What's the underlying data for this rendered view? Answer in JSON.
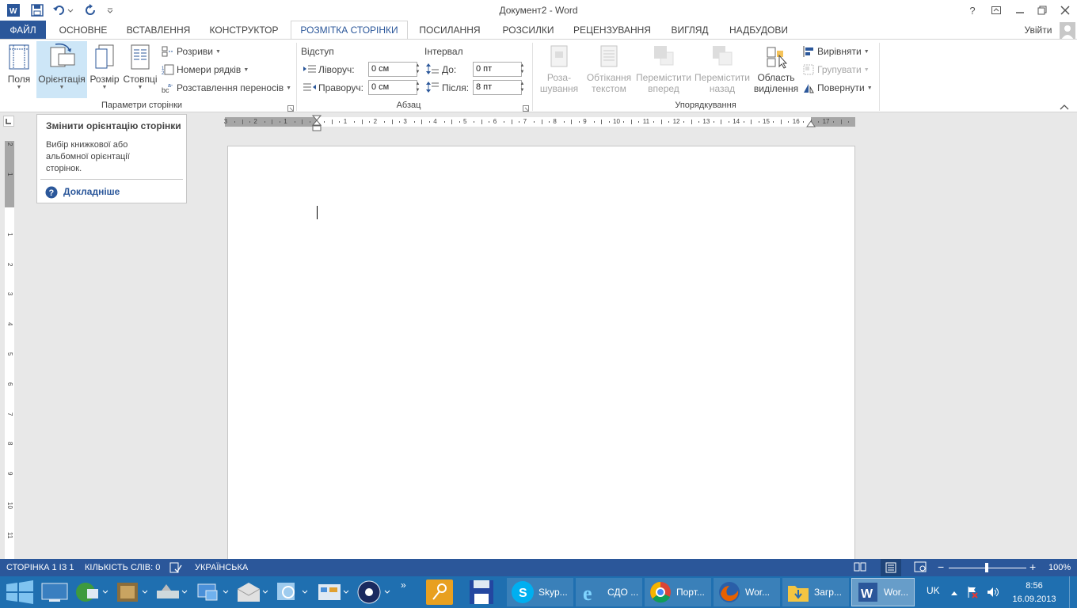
{
  "title_bar": {
    "title": "Документ2 - Word",
    "help": "?"
  },
  "tabs": {
    "file": "ФАЙЛ",
    "home": "ОСНОВНЕ",
    "insert": "ВСТАВЛЕННЯ",
    "design": "КОНСТРУКТОР",
    "layout": "РОЗМІТКА СТОРІНКИ",
    "references": "ПОСИЛАННЯ",
    "mailings": "РОЗСИЛКИ",
    "review": "РЕЦЕНЗУВАННЯ",
    "view": "ВИГЛЯД",
    "addins": "НАДБУДОВИ",
    "signin": "Увійти"
  },
  "ribbon": {
    "page_setup": {
      "label": "Параметри сторінки",
      "margins": "Поля",
      "orientation": "Орієнтація",
      "size": "Розмір",
      "columns": "Стовпці",
      "breaks": "Розриви",
      "line_numbers": "Номери рядків",
      "hyphenation": "Розставлення переносів"
    },
    "paragraph": {
      "label": "Абзац",
      "indent_title": "Відступ",
      "indent_left_label": "Ліворуч:",
      "indent_left_value": "0 см",
      "indent_right_label": "Праворуч:",
      "indent_right_value": "0 см",
      "spacing_title": "Інтервал",
      "spacing_before_label": "До:",
      "spacing_before_value": "0 пт",
      "spacing_after_label": "Після:",
      "spacing_after_value": "8 пт"
    },
    "arrange": {
      "label": "Упорядкування",
      "position_1": "Роза-",
      "position_2": "шування",
      "wrap_1": "Обтікання",
      "wrap_2": "текстом",
      "forward_1": "Перемістити",
      "forward_2": "вперед",
      "backward_1": "Перемістити",
      "backward_2": "назад",
      "selection_1": "Область",
      "selection_2": "виділення",
      "align": "Вирівняти",
      "group": "Групувати",
      "rotate": "Повернути"
    }
  },
  "tooltip": {
    "title": "Змінити орієнтацію сторінки",
    "body": "Вибір книжкової або альбомної орієнтації сторінок.",
    "more": "Докладніше"
  },
  "ruler": {
    "h_ticks": [
      "3",
      "2",
      "1",
      "1",
      "2",
      "3",
      "4",
      "5",
      "6",
      "7",
      "8",
      "9",
      "10",
      "11",
      "12",
      "13",
      "14",
      "15",
      "16",
      "17"
    ],
    "v_ticks": [
      "2",
      "1",
      "1",
      "2",
      "3",
      "4",
      "5",
      "6",
      "7",
      "8",
      "9",
      "10",
      "11"
    ]
  },
  "status_bar": {
    "page": "СТОРІНКА 1 ІЗ 1",
    "words": "КІЛЬКІСТЬ СЛІВ: 0",
    "language": "УКРАЇНСЬКА",
    "zoom": "100%"
  },
  "taskbar": {
    "skype": "Skyp...",
    "ie": "СДО ...",
    "chrome": "Порт...",
    "firefox": "Wor...",
    "explorer": "Загр...",
    "word": "Wor...",
    "lang": "UK",
    "time": "8:56",
    "date": "16.09.2013"
  },
  "colors": {
    "accent": "#2b579a",
    "taskbar": "#1f6fb0"
  }
}
